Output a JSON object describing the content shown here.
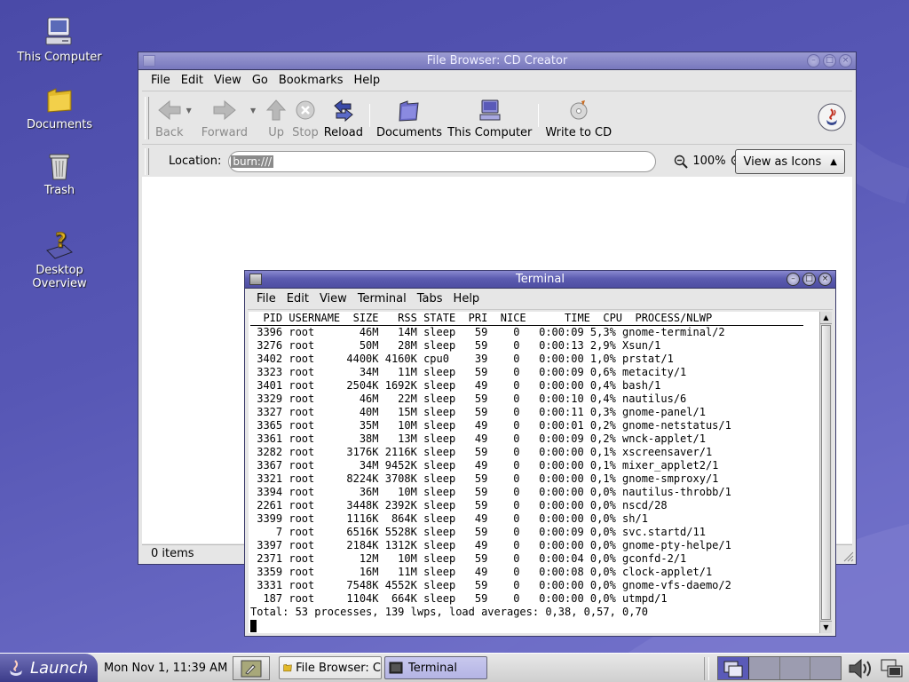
{
  "desktop": {
    "icons": [
      {
        "label": "This Computer",
        "icon": "computer-icon"
      },
      {
        "label": "Documents",
        "icon": "folder-icon"
      },
      {
        "label": "Trash",
        "icon": "trash-icon"
      },
      {
        "label": "Desktop Overview",
        "label_line1": "Desktop",
        "label_line2": "Overview",
        "icon": "help-icon"
      }
    ]
  },
  "file_browser": {
    "title": "File Browser: CD Creator",
    "menu": [
      "File",
      "Edit",
      "View",
      "Go",
      "Bookmarks",
      "Help"
    ],
    "toolbar": {
      "back": "Back",
      "forward": "Forward",
      "up": "Up",
      "stop": "Stop",
      "reload": "Reload",
      "documents": "Documents",
      "this_computer": "This Computer",
      "write_to_cd": "Write to CD"
    },
    "location_label": "Location:",
    "location_value": "burn:///",
    "zoom": "100%",
    "view_as": "View as Icons",
    "status": "0 items"
  },
  "terminal": {
    "title": "Terminal",
    "menu": [
      "File",
      "Edit",
      "View",
      "Terminal",
      "Tabs",
      "Help"
    ],
    "header": "  PID USERNAME  SIZE   RSS STATE  PRI  NICE      TIME  CPU  PROCESS/NLWP",
    "rows": [
      " 3396 root       46M   14M sleep   59    0   0:00:09 5,3% gnome-terminal/2",
      " 3276 root       50M   28M sleep   59    0   0:00:13 2,9% Xsun/1",
      " 3402 root     4400K 4160K cpu0    39    0   0:00:00 1,0% prstat/1",
      " 3323 root       34M   11M sleep   59    0   0:00:09 0,6% metacity/1",
      " 3401 root     2504K 1692K sleep   49    0   0:00:00 0,4% bash/1",
      " 3329 root       46M   22M sleep   59    0   0:00:10 0,4% nautilus/6",
      " 3327 root       40M   15M sleep   59    0   0:00:11 0,3% gnome-panel/1",
      " 3365 root       35M   10M sleep   49    0   0:00:01 0,2% gnome-netstatus/1",
      " 3361 root       38M   13M sleep   49    0   0:00:09 0,2% wnck-applet/1",
      " 3282 root     3176K 2116K sleep   59    0   0:00:00 0,1% xscreensaver/1",
      " 3367 root       34M 9452K sleep   49    0   0:00:00 0,1% mixer_applet2/1",
      " 3321 root     8224K 3708K sleep   59    0   0:00:00 0,1% gnome-smproxy/1",
      " 3394 root       36M   10M sleep   59    0   0:00:00 0,0% nautilus-throbb/1",
      " 2261 root     3448K 2392K sleep   59    0   0:00:00 0,0% nscd/28",
      " 3399 root     1116K  864K sleep   49    0   0:00:00 0,0% sh/1",
      "    7 root     6516K 5528K sleep   59    0   0:00:09 0,0% svc.startd/11",
      " 3397 root     2184K 1312K sleep   49    0   0:00:00 0,0% gnome-pty-helpe/1",
      " 2371 root       12M   10M sleep   59    0   0:00:04 0,0% gconfd-2/1",
      " 3359 root       16M   11M sleep   49    0   0:00:08 0,0% clock-applet/1",
      " 3331 root     7548K 4552K sleep   59    0   0:00:00 0,0% gnome-vfs-daemo/2",
      "  187 root     1104K  664K sleep   59    0   0:00:00 0,0% utmpd/1"
    ],
    "total": "Total: 53 processes, 139 lwps, load averages: 0,38, 0,57, 0,70"
  },
  "panel": {
    "launch": "Launch",
    "clock": "Mon Nov  1, 11:39 AM",
    "tasks": [
      "File Browser: C",
      "Terminal"
    ]
  }
}
